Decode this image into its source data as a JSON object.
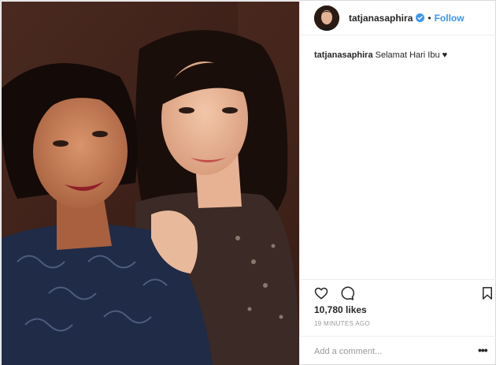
{
  "post": {
    "username": "tatjanasaphira",
    "verified_icon": "verified-badge-icon",
    "separator": "•",
    "follow_label": "Follow",
    "caption_user": "tatjanasaphira",
    "caption_text": "Selamat Hari Ibu ♥",
    "likes": "10,780 likes",
    "timestamp": "19 MINUTES AGO",
    "comment_placeholder": "Add a comment...",
    "more_label": "•••"
  },
  "icons": {
    "like": "heart-icon",
    "comment": "comment-bubble-icon",
    "save": "bookmark-icon"
  },
  "colors": {
    "link": "#3897f0",
    "verified": "#3897f0",
    "meta_text": "#999999",
    "border": "#efefef"
  }
}
